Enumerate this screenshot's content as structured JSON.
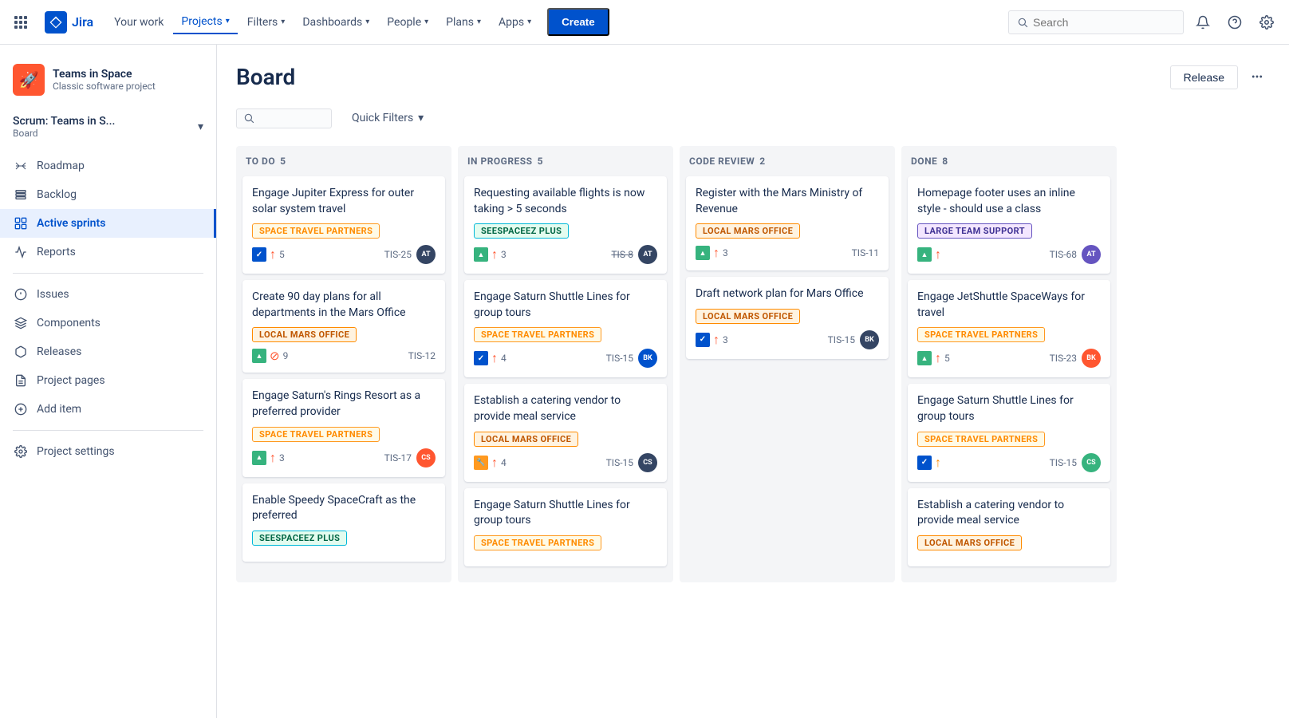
{
  "topnav": {
    "logo_text": "Jira",
    "menu_items": [
      {
        "label": "Your work",
        "active": false
      },
      {
        "label": "Projects",
        "active": true
      },
      {
        "label": "Filters",
        "active": false
      },
      {
        "label": "Dashboards",
        "active": false
      },
      {
        "label": "People",
        "active": false
      },
      {
        "label": "Plans",
        "active": false
      },
      {
        "label": "Apps",
        "active": false
      }
    ],
    "create_label": "Create",
    "search_placeholder": "Search"
  },
  "sidebar": {
    "project_name": "Teams in Space",
    "project_type": "Classic software project",
    "scrum_title": "Scrum: Teams in S...",
    "scrum_subtitle": "Board",
    "nav_items": [
      {
        "label": "Roadmap",
        "icon": "roadmap",
        "active": false
      },
      {
        "label": "Backlog",
        "icon": "backlog",
        "active": false
      },
      {
        "label": "Active sprints",
        "icon": "sprint",
        "active": true
      },
      {
        "label": "Reports",
        "icon": "reports",
        "active": false
      },
      {
        "label": "Issues",
        "icon": "issues",
        "active": false
      },
      {
        "label": "Components",
        "icon": "components",
        "active": false
      },
      {
        "label": "Releases",
        "icon": "releases",
        "active": false
      },
      {
        "label": "Project pages",
        "icon": "pages",
        "active": false
      },
      {
        "label": "Add item",
        "icon": "add",
        "active": false
      },
      {
        "label": "Project settings",
        "icon": "settings",
        "active": false
      }
    ]
  },
  "board": {
    "title": "Board",
    "release_btn": "Release",
    "filter_placeholder": "",
    "quick_filters": "Quick Filters",
    "columns": [
      {
        "title": "TO DO",
        "count": 5,
        "cards": [
          {
            "title": "Engage Jupiter Express for outer solar system travel",
            "label": "SPACE TRAVEL PARTNERS",
            "label_color": "yellow",
            "icons": [
              "check-blue",
              "arrow-up-red"
            ],
            "sp": "5",
            "id": "TIS-25",
            "avatar_color": "dark"
          },
          {
            "title": "Create 90 day plans for all departments in the Mars Office",
            "label": "LOCAL MARS OFFICE",
            "label_color": "orange",
            "icons": [
              "story-green",
              "block-red"
            ],
            "sp": "9",
            "id": "TIS-12",
            "avatar_color": ""
          },
          {
            "title": "Engage Saturn's Rings Resort as a preferred provider",
            "label": "SPACE TRAVEL PARTNERS",
            "label_color": "yellow",
            "icons": [
              "story-green",
              "arrow-up-red"
            ],
            "sp": "3",
            "id": "TIS-17",
            "avatar_color": "orange"
          },
          {
            "title": "Enable Speedy SpaceCraft as the preferred",
            "label": "SEESPACEEZ PLUS",
            "label_color": "teal",
            "icons": [],
            "sp": "",
            "id": "",
            "avatar_color": ""
          }
        ]
      },
      {
        "title": "IN PROGRESS",
        "count": 5,
        "cards": [
          {
            "title": "Requesting available flights is now taking > 5 seconds",
            "label": "SEESPACEEZ PLUS",
            "label_color": "teal",
            "icons": [
              "story-green",
              "arrow-up-red"
            ],
            "sp": "3",
            "id": "TIS-8",
            "id_strike": true,
            "avatar_color": "dark"
          },
          {
            "title": "Engage Saturn Shuttle Lines for group tours",
            "label": "SPACE TRAVEL PARTNERS",
            "label_color": "yellow",
            "icons": [
              "check-blue",
              "arrow-up-red"
            ],
            "sp": "4",
            "id": "TIS-15",
            "avatar_color": "blue"
          },
          {
            "title": "Establish a catering vendor to provide meal service",
            "label": "LOCAL MARS OFFICE",
            "label_color": "orange",
            "icons": [
              "wrench-orange",
              "arrow-up-red"
            ],
            "sp": "4",
            "id": "TIS-15",
            "avatar_color": "dark"
          },
          {
            "title": "Engage Saturn Shuttle Lines for group tours",
            "label": "SPACE TRAVEL PARTNERS",
            "label_color": "yellow",
            "icons": [],
            "sp": "",
            "id": "",
            "avatar_color": ""
          }
        ]
      },
      {
        "title": "CODE REVIEW",
        "count": 2,
        "cards": [
          {
            "title": "Register with the Mars Ministry of Revenue",
            "label": "LOCAL MARS OFFICE",
            "label_color": "orange",
            "icons": [
              "story-green",
              "arrow-up-red"
            ],
            "sp": "3",
            "id": "TIS-11",
            "avatar_color": ""
          },
          {
            "title": "Draft network plan for Mars Office",
            "label": "LOCAL MARS OFFICE",
            "label_color": "orange",
            "icons": [
              "check-blue",
              "arrow-up-red"
            ],
            "sp": "3",
            "id": "TIS-15",
            "avatar_color": "dark"
          }
        ]
      },
      {
        "title": "DONE",
        "count": 8,
        "cards": [
          {
            "title": "Homepage footer uses an inline style - should use a class",
            "label": "LARGE TEAM SUPPORT",
            "label_color": "purple",
            "icons": [
              "story-green",
              "arrow-up-red"
            ],
            "sp": "",
            "id": "TIS-68",
            "avatar_color": "purple"
          },
          {
            "title": "Engage JetShuttle SpaceWays for travel",
            "label": "SPACE TRAVEL PARTNERS",
            "label_color": "yellow",
            "icons": [
              "story-green",
              "arrow-up-red"
            ],
            "sp": "5",
            "id": "TIS-23",
            "avatar_color": "orange"
          },
          {
            "title": "Engage Saturn Shuttle Lines for group tours",
            "label": "SPACE TRAVEL PARTNERS",
            "label_color": "yellow",
            "icons": [
              "check-blue",
              "arrow-up-orange"
            ],
            "sp": "",
            "id": "TIS-15",
            "avatar_color": "green"
          },
          {
            "title": "Establish a catering vendor to provide meal service",
            "label": "LOCAL MARS OFFICE",
            "label_color": "orange",
            "icons": [],
            "sp": "",
            "id": "",
            "avatar_color": ""
          }
        ]
      }
    ]
  }
}
